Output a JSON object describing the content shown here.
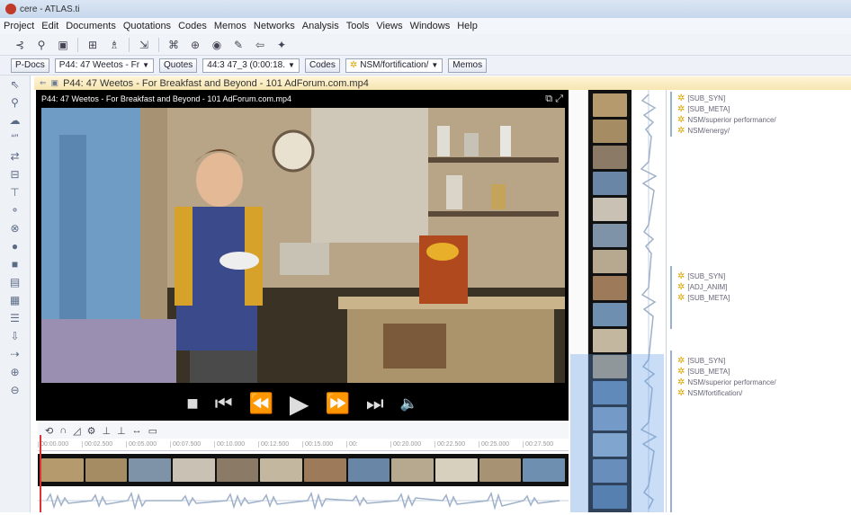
{
  "window": {
    "title": "cere - ATLAS.ti"
  },
  "menu": [
    "Project",
    "Edit",
    "Documents",
    "Quotations",
    "Codes",
    "Memos",
    "Networks",
    "Analysis",
    "Tools",
    "Views",
    "Windows",
    "Help"
  ],
  "navbar": {
    "pdocs_label": "P-Docs",
    "pdoc_value": "P44: 47 Weetos - Fr",
    "quotes_label": "Quotes",
    "quote_value": "44:3 47_3 (0:00:18.",
    "codes_label": "Codes",
    "code_value": "NSM/fortification/",
    "memos_label": "Memos"
  },
  "document": {
    "header": "P44: 47 Weetos - For Breakfast and Beyond - 101   AdForum.com.mp4",
    "video_caption": "P44: 47 Weetos - For Breakfast and Beyond - 101   AdForum.com.mp4"
  },
  "ruler_ticks": [
    "00:00.000",
    "00:02.500",
    "00:05.000",
    "00:07.500",
    "00:10.000",
    "00:12.500",
    "00:15.000",
    "00:",
    "00:20.000",
    "00:22.500",
    "00:25.000",
    "00:27.500"
  ],
  "margin": {
    "group1": [
      "[SUB_SYN]",
      "[SUB_META]",
      "NSM/superior performance/",
      "NSM/energy/"
    ],
    "group2": [
      "[SUB_SYN]",
      "[ADJ_ANIM]",
      "[SUB_META]"
    ],
    "group3": [
      "[SUB_SYN]",
      "[SUB_META]",
      "NSM/superior performance/",
      "NSM/fortification/"
    ]
  }
}
